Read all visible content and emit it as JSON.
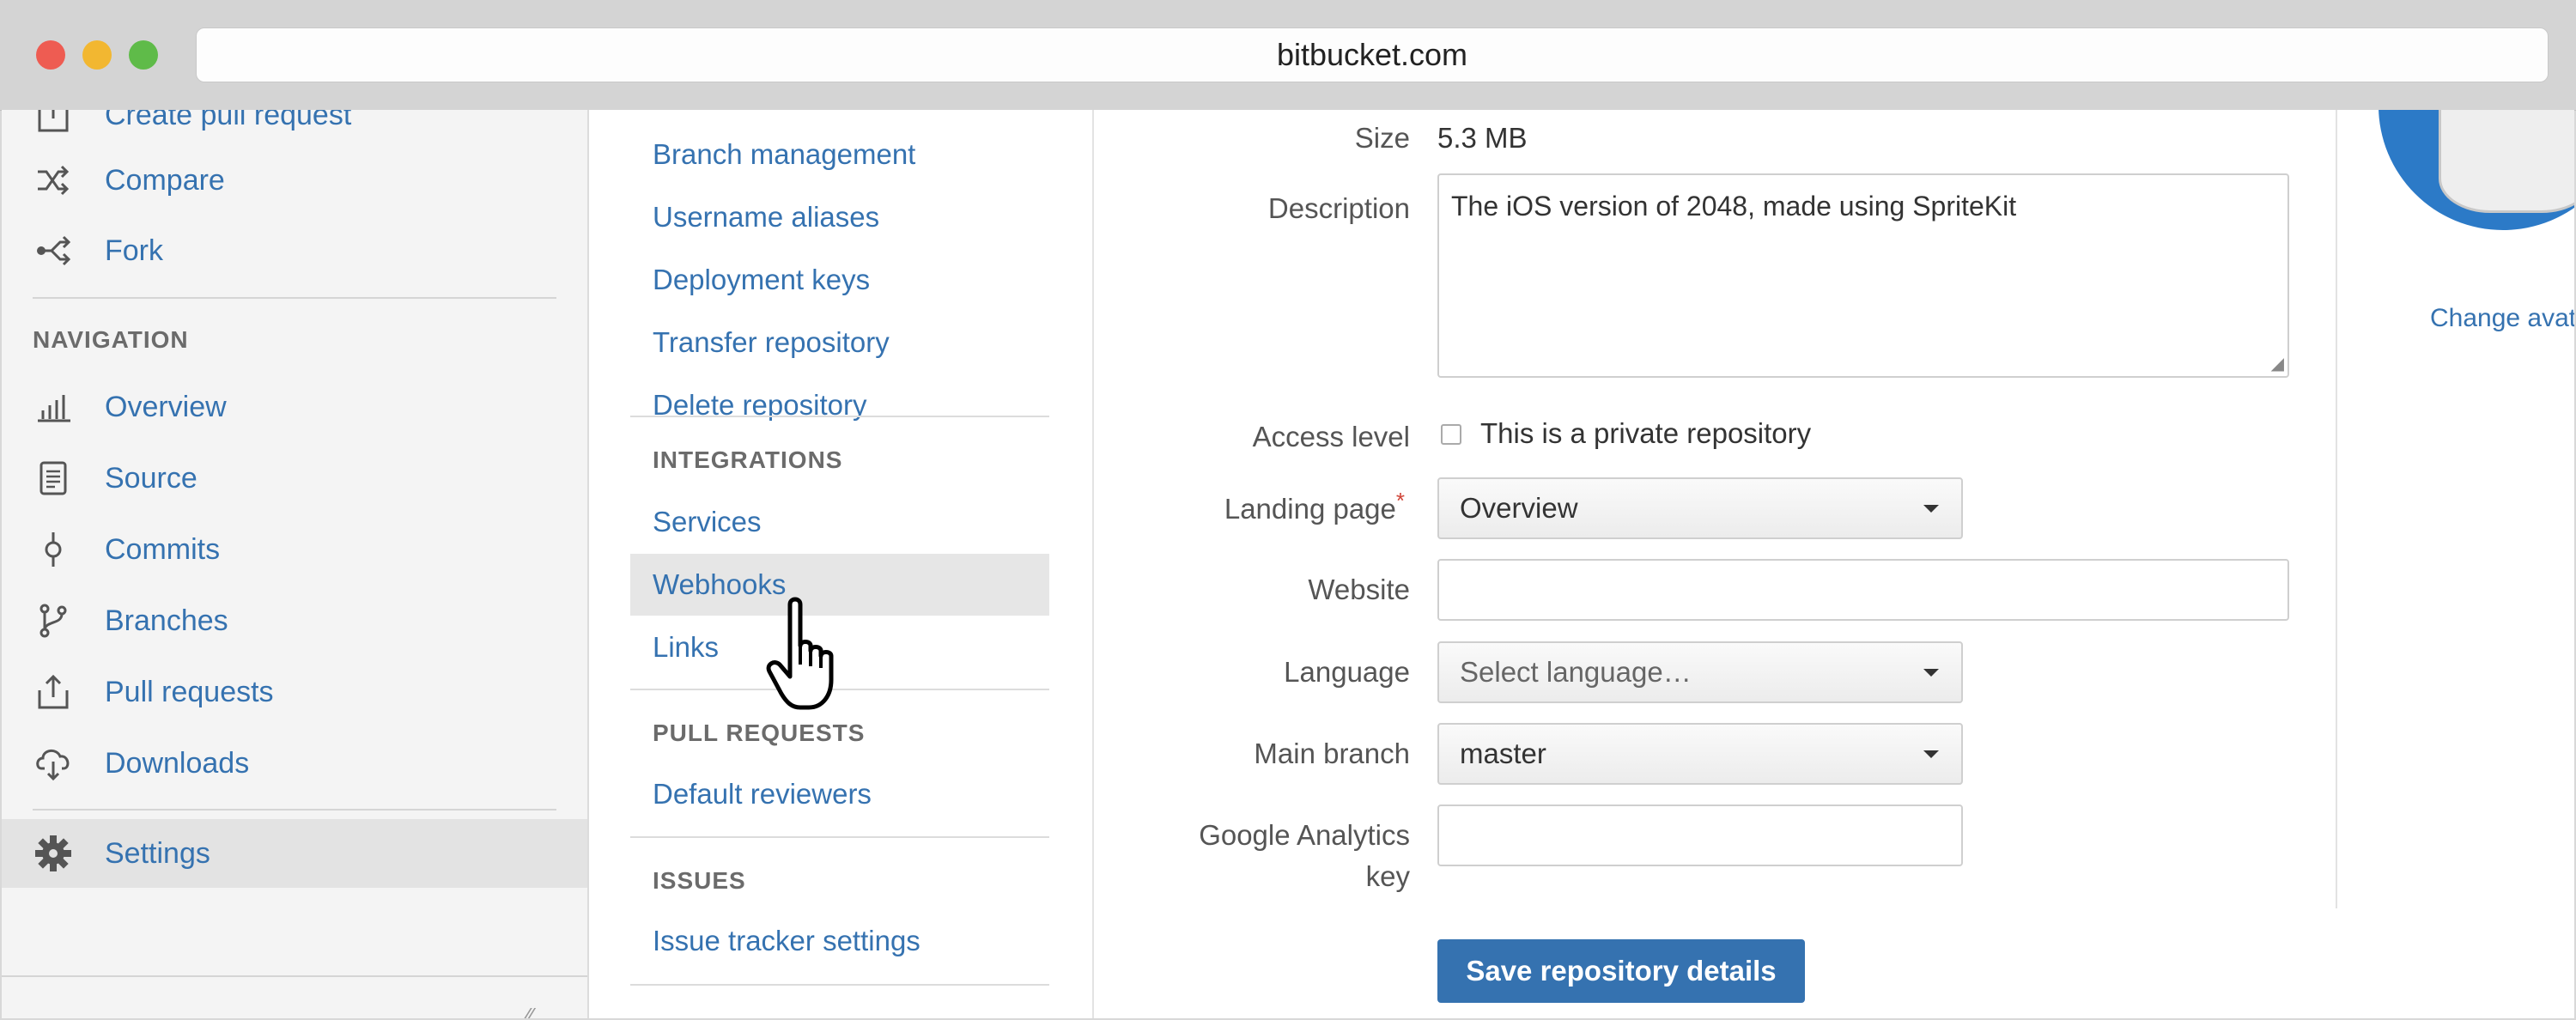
{
  "browser": {
    "url": "bitbucket.com"
  },
  "sidebar": {
    "top_items": [
      {
        "label": "Create pull request",
        "icon": "create-pull-request-icon"
      },
      {
        "label": "Compare",
        "icon": "compare-icon"
      },
      {
        "label": "Fork",
        "icon": "fork-icon"
      }
    ],
    "navigation_heading": "NAVIGATION",
    "nav_items": [
      {
        "label": "Overview",
        "icon": "overview-icon"
      },
      {
        "label": "Source",
        "icon": "source-icon"
      },
      {
        "label": "Commits",
        "icon": "commits-icon"
      },
      {
        "label": "Branches",
        "icon": "branches-icon"
      },
      {
        "label": "Pull requests",
        "icon": "pull-requests-icon"
      },
      {
        "label": "Downloads",
        "icon": "downloads-icon"
      }
    ],
    "settings": {
      "label": "Settings",
      "icon": "gear-icon",
      "active": true
    }
  },
  "settings_menu": {
    "general_items": [
      "Branch management",
      "Username aliases",
      "Deployment keys",
      "Transfer repository",
      "Delete repository"
    ],
    "integrations_heading": "INTEGRATIONS",
    "integrations_items": [
      "Services",
      "Webhooks",
      "Links"
    ],
    "active_item": "Webhooks",
    "pull_requests_heading": "PULL REQUESTS",
    "pull_requests_items": [
      "Default reviewers"
    ],
    "issues_heading": "ISSUES",
    "issues_items": [
      "Issue tracker settings"
    ]
  },
  "form": {
    "size_label": "Size",
    "size_value": "5.3 MB",
    "description_label": "Description",
    "description_value": "The iOS version of 2048, made using SpriteKit",
    "access_label": "Access level",
    "access_checkbox_label": "This is a private repository",
    "access_private": false,
    "landing_label": "Landing page",
    "landing_required_mark": "*",
    "landing_value": "Overview",
    "website_label": "Website",
    "website_value": "",
    "language_label": "Language",
    "language_placeholder": "Select language…",
    "main_branch_label": "Main branch",
    "main_branch_value": "master",
    "analytics_label_line1": "Google Analytics",
    "analytics_label_line2": "key",
    "analytics_value": "",
    "save_label": "Save repository details"
  },
  "avatar": {
    "change_label": "Change avata"
  },
  "colors": {
    "link": "#3572b0",
    "button": "#3572b0",
    "required": "#d04437",
    "avatar": "#2c7ac7"
  }
}
